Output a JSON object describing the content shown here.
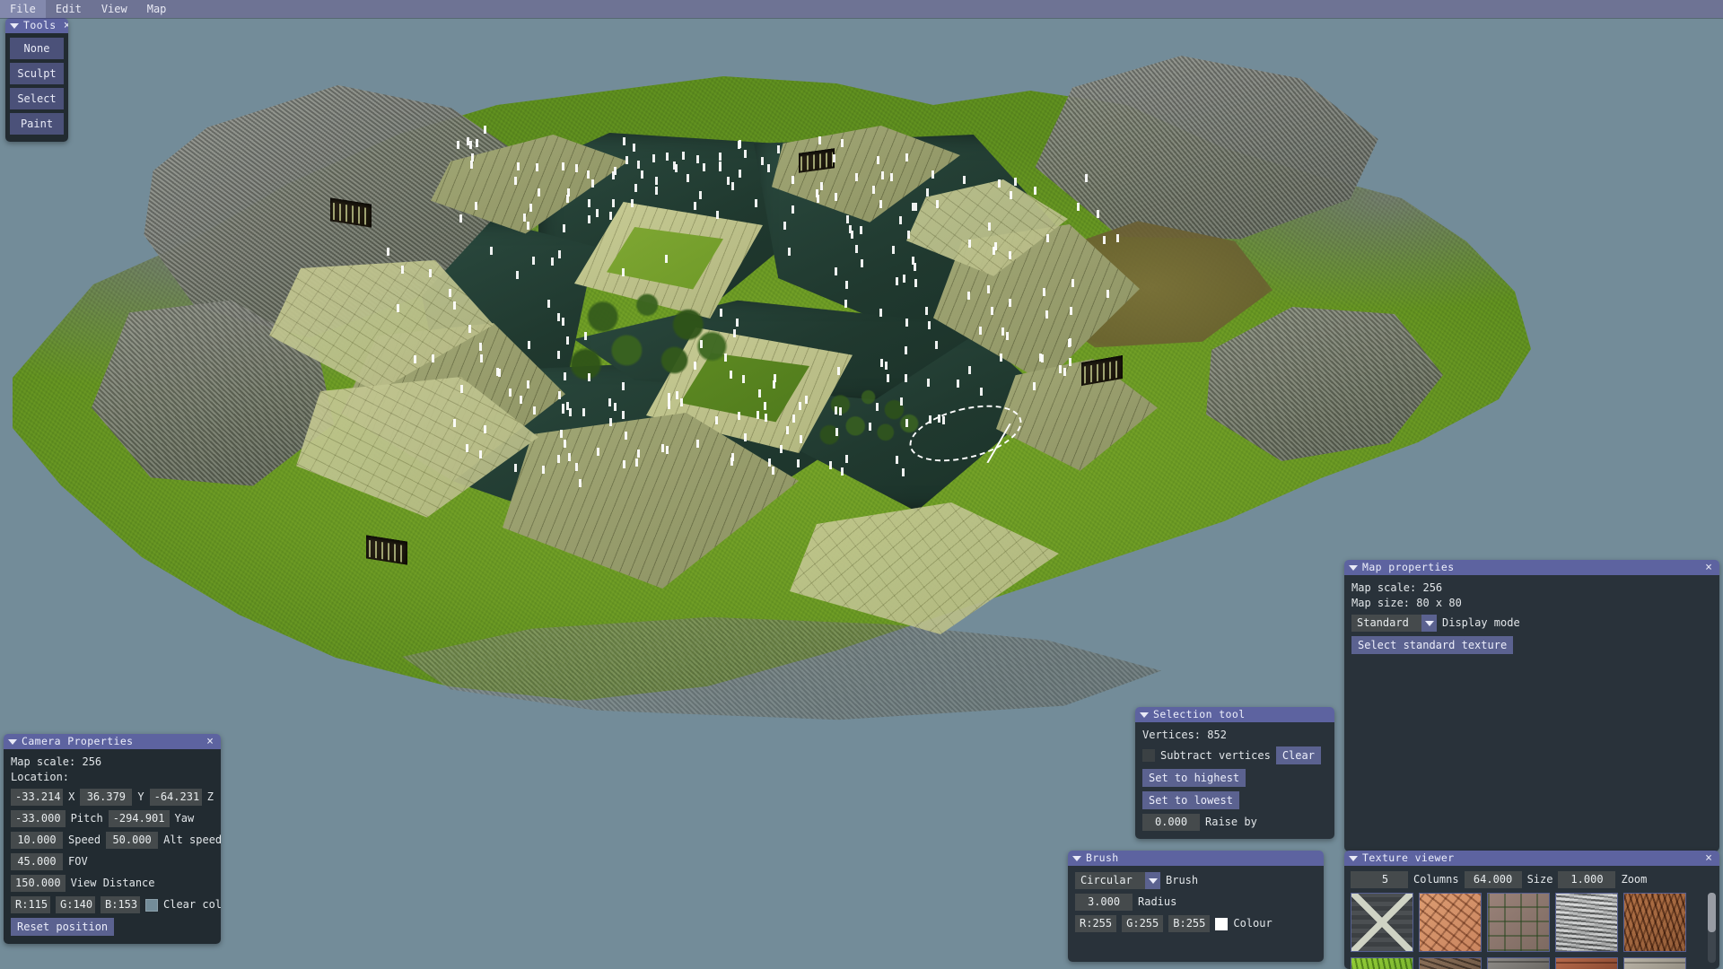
{
  "menubar": {
    "items": [
      {
        "label": "File"
      },
      {
        "label": "Edit"
      },
      {
        "label": "View"
      },
      {
        "label": "Map"
      }
    ]
  },
  "tools_panel": {
    "title": "Tools",
    "close": "×",
    "buttons": [
      {
        "label": "None"
      },
      {
        "label": "Sculpt"
      },
      {
        "label": "Select"
      },
      {
        "label": "Paint"
      }
    ]
  },
  "camera_panel": {
    "title": "Camera Properties",
    "close": "×",
    "map_scale_label": "Map scale: 256",
    "location_label": "Location:",
    "x_value": "-33.214",
    "x_label": "X",
    "y_value": "36.379",
    "y_label": "Y",
    "z_value": "-64.231",
    "z_label": "Z",
    "pitch_value": "-33.000",
    "pitch_label": "Pitch",
    "yaw_value": "-294.901",
    "yaw_label": "Yaw",
    "speed_value": "10.000",
    "speed_label": "Speed",
    "alt_speed_value": "50.000",
    "alt_speed_label": "Alt speed",
    "fov_value": "45.000",
    "fov_label": "FOV",
    "view_distance_value": "150.000",
    "view_distance_label": "View Distance",
    "r_value": "R:115",
    "g_value": "G:140",
    "b_value": "B:153",
    "clear_colour_label": "Clear colour",
    "clear_colour_hex": "#738C99",
    "reset_label": "Reset position"
  },
  "selection_panel": {
    "title": "Selection tool",
    "vertices_label": "Vertices: 852",
    "subtract_label": "Subtract vertices",
    "clear_label": "Clear",
    "set_highest_label": "Set to highest",
    "set_lowest_label": "Set to lowest",
    "raise_value": "0.000",
    "raise_label": "Raise by"
  },
  "brush_panel": {
    "title": "Brush",
    "shape_value": "Circular",
    "shape_label": "Brush",
    "radius_value": "3.000",
    "radius_label": "Radius",
    "r_value": "R:255",
    "g_value": "G:255",
    "b_value": "B:255",
    "colour_label": "Colour",
    "colour_hex": "#FFFFFF"
  },
  "map_properties_panel": {
    "title": "Map properties",
    "close": "×",
    "map_scale_label": "Map scale: 256",
    "map_size_label": "Map size: 80 x 80",
    "display_mode_value": "Standard",
    "display_mode_label": "Display mode",
    "select_texture_label": "Select standard texture"
  },
  "texture_viewer_panel": {
    "title": "Texture viewer",
    "close": "×",
    "columns_value": "5",
    "columns_label": "Columns",
    "size_value": "64.000",
    "size_label": "Size",
    "zoom_value": "1.000",
    "zoom_label": "Zoom",
    "thumbnails": [
      {
        "name": "crate-texture"
      },
      {
        "name": "sandstone-texture"
      },
      {
        "name": "mossy-cobble-texture"
      },
      {
        "name": "gravel-texture"
      },
      {
        "name": "bark-texture"
      }
    ],
    "thumbnails_row2": [
      {
        "name": "grass-texture"
      },
      {
        "name": "dirt-texture"
      },
      {
        "name": "stone-texture"
      },
      {
        "name": "brick-texture"
      },
      {
        "name": "pale-stone-texture"
      }
    ]
  },
  "viewport": {
    "name": "3d-terrain-viewport",
    "sky_colour": "#738C99",
    "selected_vertex_colour": "#FFFFFF"
  }
}
